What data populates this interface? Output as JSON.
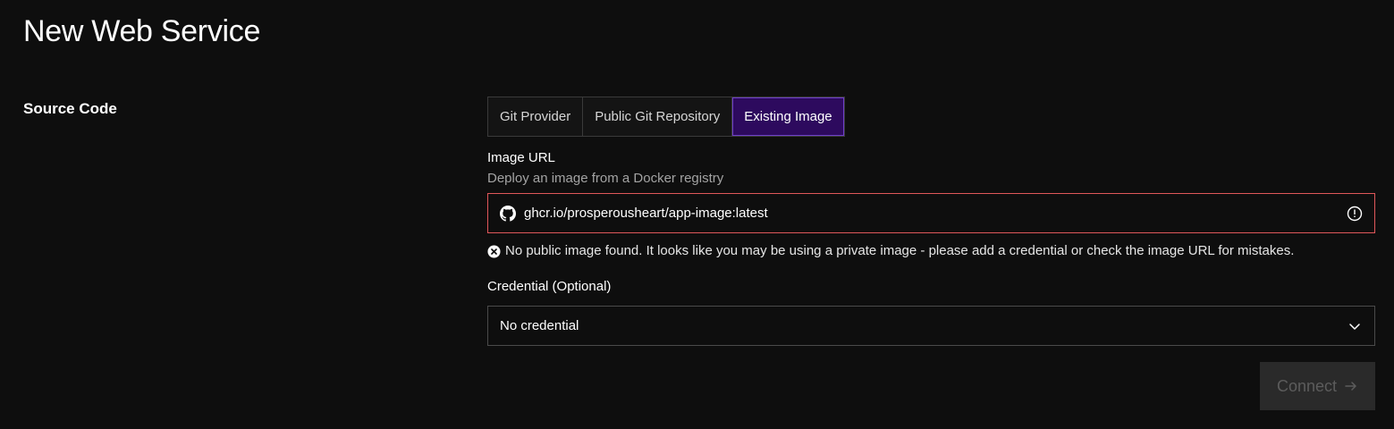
{
  "page": {
    "title": "New Web Service"
  },
  "source_code": {
    "label": "Source Code",
    "tabs": [
      {
        "label": "Git Provider",
        "active": false
      },
      {
        "label": "Public Git Repository",
        "active": false
      },
      {
        "label": "Existing Image",
        "active": true
      }
    ]
  },
  "image_url": {
    "label": "Image URL",
    "help": "Deploy an image from a Docker registry",
    "value": "ghcr.io/prosperousheart/app-image:latest",
    "leading_icon": "github-icon",
    "trailing_icon": "warning-circle-icon",
    "error": "No public image found. It looks like you may be using a private image - please add a credential or check the image URL for mistakes.",
    "error_icon": "error-x-circle-icon"
  },
  "credential": {
    "label": "Credential (Optional)",
    "selected": "No credential"
  },
  "actions": {
    "connect_label": "Connect",
    "connect_icon": "arrow-right-icon",
    "connect_enabled": false
  },
  "colors": {
    "background": "#0e0e0e",
    "active_tab": "#2d0a5e",
    "error_border": "#e0575a",
    "disabled_button": "#2a2a2a"
  }
}
